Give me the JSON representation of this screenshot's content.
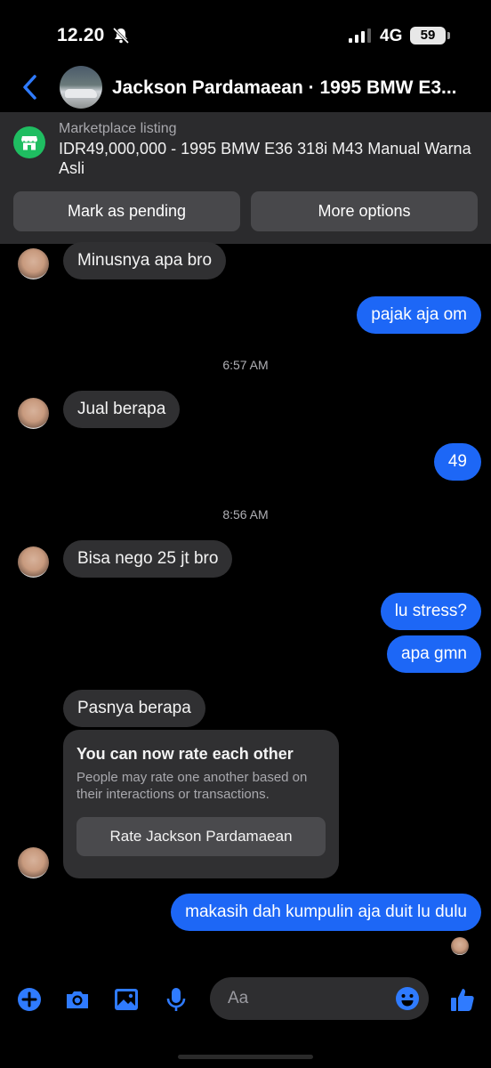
{
  "status_bar": {
    "time": "12.20",
    "network": "4G",
    "battery": "59"
  },
  "header": {
    "title": "Jackson Pardamaean · 1995 BMW E3..."
  },
  "marketplace": {
    "caption": "Marketplace listing",
    "listing": "IDR49,000,000 - 1995 BMW E36 318i M43 Manual Warna Asli",
    "pending_label": "Mark as pending",
    "more_label": "More options"
  },
  "messages": [
    {
      "from": "them",
      "text": "Minusnya apa bro"
    },
    {
      "from": "me",
      "text": "pajak aja om"
    },
    {
      "from": "them",
      "text": "Jual berapa"
    },
    {
      "from": "me",
      "text": "49"
    },
    {
      "from": "them",
      "text": "Bisa nego 25 jt bro"
    },
    {
      "from": "me",
      "text": "lu stress?"
    },
    {
      "from": "me",
      "text": "apa gmn"
    },
    {
      "from": "them",
      "text": "Pasnya berapa"
    },
    {
      "from": "me",
      "text": "makasih dah kumpulin aja duit lu dulu"
    }
  ],
  "timestamps": [
    "6:57 AM",
    "8:56 AM"
  ],
  "rate_card": {
    "title": "You can now rate each other",
    "description": "People may rate one another based on their interactions or transactions.",
    "button": "Rate Jackson Pardamaean"
  },
  "composer": {
    "placeholder": "Aa"
  },
  "colors": {
    "accent": "#1d67f6",
    "incoming": "#303032",
    "marketplace": "#1fbd61"
  }
}
